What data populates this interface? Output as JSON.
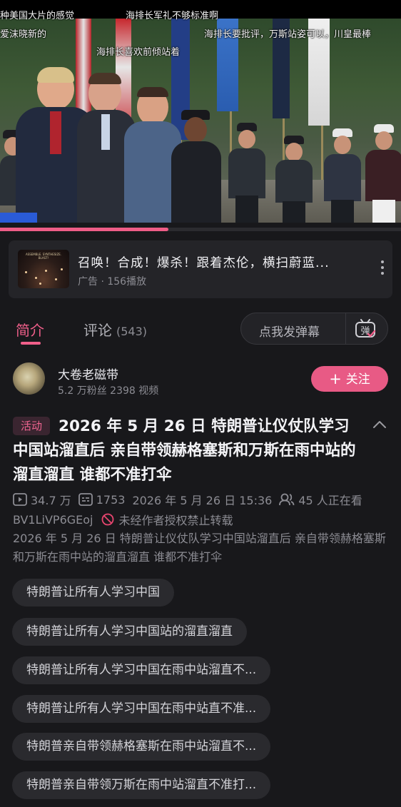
{
  "video": {
    "danmaku": [
      "种美国大片的感觉",
      "海排长军礼不够标准啊",
      "爱沫晓新的",
      "海排长要批评，万斯站姿可以，川皇最棒",
      "海排长喜欢前倾站着"
    ],
    "progress_fraction": 0.42
  },
  "ad": {
    "thumb_title": "ASSEMBLE. SYNTHESIZE. BLAST!",
    "title": "召唤！合成！爆杀！跟着杰伦，横扫蔚蓝...",
    "meta": "广告 · 156播放"
  },
  "tabs": {
    "intro": "简介",
    "comments": "评论",
    "comments_count": "(543)",
    "danmaku_placeholder": "点我发弹幕",
    "danmaku_icon_text": "弹"
  },
  "author": {
    "name": "大卷老磁带",
    "stats": "5.2 万粉丝  2398 视频",
    "follow_plus": "+",
    "follow_label": "关注"
  },
  "video_info": {
    "badge": "活动",
    "title": "2026 年 5 月 26 日 特朗普让仪仗队学习中国站溜直后 亲自带领赫格塞斯和万斯在雨中站的溜直溜直 谁都不准打伞",
    "views": "34.7 万",
    "danmaku_count": "1753",
    "date": "2026 年 5 月 26 日 15:36",
    "watching": "45 人正在看",
    "bvid": "BV1LiVP6GEoj",
    "copyright": "未经作者授权禁止转载",
    "description": "2026 年 5 月 26 日 特朗普让仪仗队学习中国站溜直后 亲自带领赫格塞斯和万斯在雨中站的溜直溜直 谁都不准打伞"
  },
  "tags": [
    "特朗普让所有人学习中国",
    "特朗普让所有人学习中国站的溜直溜直",
    "特朗普让所有人学习中国在雨中站溜直不...",
    "特朗普让所有人学习中国在雨中站直不准...",
    "特朗普亲自带领赫格塞斯在雨中站溜直不...",
    "特朗普亲自带领万斯在雨中站溜直不准打..."
  ],
  "colors": {
    "accent": "#f05f8a",
    "follow_button": "#e85a85",
    "background": "#18181b"
  }
}
